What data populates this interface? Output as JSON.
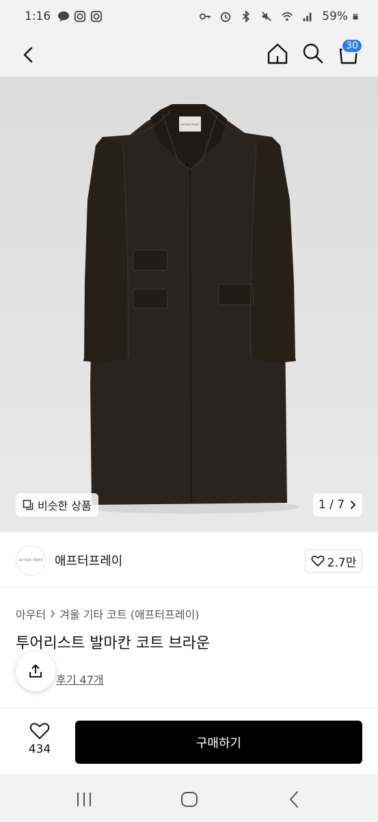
{
  "status_bar": {
    "time": "1:16",
    "battery": "59%"
  },
  "header": {
    "cart_count": "30"
  },
  "gallery": {
    "similar_label": "비슷한 상품",
    "page_indicator": "1 / 7",
    "coat_label_text": "AFTER PRAY"
  },
  "brand": {
    "logo_text": "AFTER PRAY",
    "name": "애프터프레이",
    "likes": "2.7만"
  },
  "product": {
    "breadcrumb": [
      "아우터",
      "겨울 기타 코트 (애프터프레이)"
    ],
    "title": "투어리스트 발마칸 코트 브라운",
    "review_link": "후기 47개"
  },
  "purchase": {
    "wish_count": "434",
    "buy_label": "구매하기"
  },
  "colors": {
    "accent": "#2e7bf6",
    "coat": "#2a2420",
    "buy_button": "#000000"
  }
}
